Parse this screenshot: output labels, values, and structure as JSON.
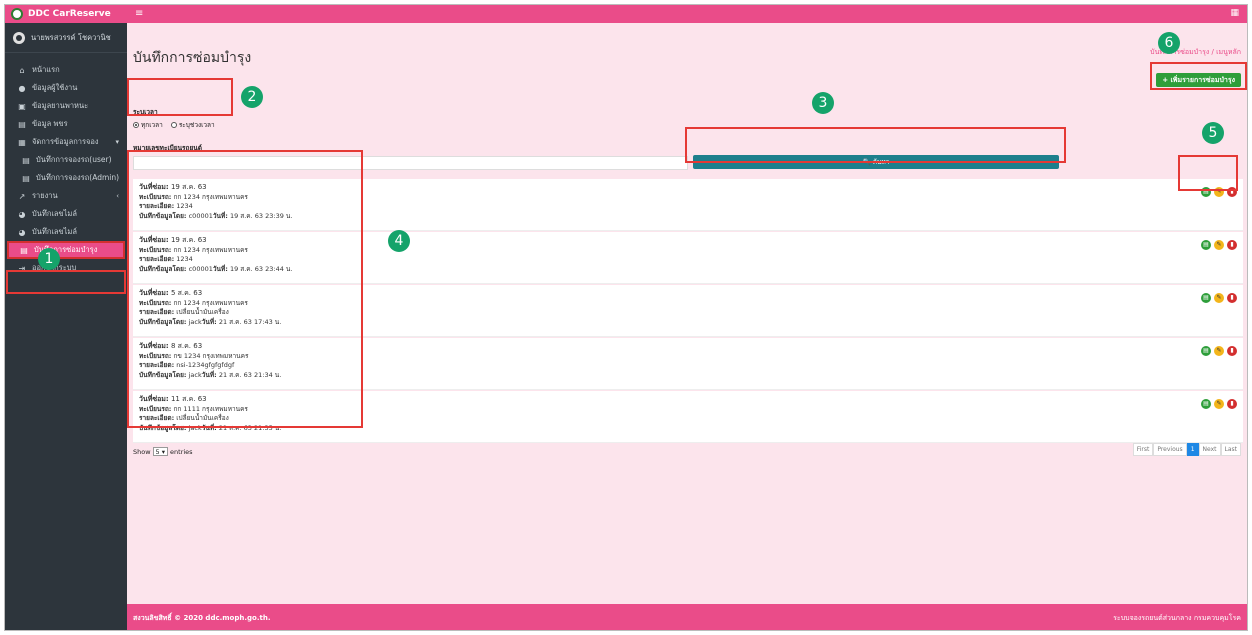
{
  "app": {
    "brand": "DDC CarReserve",
    "user_name": "นายพรสวรรค์ โชควานิช"
  },
  "sidebar": {
    "items": [
      {
        "icon": "home-icon",
        "label": "หน้าแรก"
      },
      {
        "icon": "user-icon",
        "label": "ข้อมูลผู้ใช้งาน"
      },
      {
        "icon": "car-icon",
        "label": "ข้อมูลยานพาหนะ"
      },
      {
        "icon": "card-icon",
        "label": "ข้อมูล พขร"
      },
      {
        "icon": "calendar-icon",
        "label": "จัดการข้อมูลการจอง"
      },
      {
        "icon": "list-icon",
        "label": "บันทึกการจองรถ(user)"
      },
      {
        "icon": "list-icon",
        "label": "บันทึกการจองรถ(Admin)"
      },
      {
        "icon": "chart-icon",
        "label": "รายงาน"
      },
      {
        "icon": "mileage-icon",
        "label": "บันทึกเลขไมล์"
      },
      {
        "icon": "mileage-icon",
        "label": "บันทึกเลขไมล์"
      },
      {
        "icon": "wrench-icon",
        "label": "บันทึกการซ่อมบำรุง"
      },
      {
        "icon": "logout-icon",
        "label": "ออกจากระบบ"
      }
    ]
  },
  "page": {
    "title": "บันทึกการซ่อมบำรุง",
    "breadcrumb": "บันทึกการซ่อมบำรุง / เมนูหลัก",
    "add_button": "+ เพิ่มรายการซ่อมบำรุง"
  },
  "filter": {
    "range_label": "ระบุเวลา",
    "opt_all": "ทุกเวลา",
    "opt_range": "ระบุช่วงเวลา",
    "plate_label": "หมายเลขทะเบียนรถยนต์",
    "search_button": "🔍 ค้นหา"
  },
  "labels": {
    "date": "วันที่ซ่อม:",
    "plate": "ทะเบียนรถ:",
    "detail": "รายละเอียด:",
    "recorder": "บันทึกข้อมูลโดย:",
    "recorded_at": "วันที่:"
  },
  "records": [
    {
      "date": "19 ส.ค. 63",
      "plate": "กก 1234 กรุงเทพมหานคร",
      "detail": "1234",
      "by": "c00001",
      "at": "19 ส.ค. 63 23:39 น."
    },
    {
      "date": "19 ส.ค. 63",
      "plate": "กก 1234 กรุงเทพมหานคร",
      "detail": "1234",
      "by": "c00001",
      "at": "19 ส.ค. 63 23:44 น."
    },
    {
      "date": "5 ส.ค. 63",
      "plate": "กก 1234 กรุงเทพมหานคร",
      "detail": "เปลี่ยนน้ำมันเครื่อง",
      "by": "jack",
      "at": "21 ส.ค. 63 17:43 น."
    },
    {
      "date": "8 ส.ค. 63",
      "plate": "กข 1234 กรุงเทพมหานคร",
      "detail": "nsi-1234gfgfgfdgf",
      "by": "jack",
      "at": "21 ส.ค. 63 21:34 น."
    },
    {
      "date": "11 ส.ค. 63",
      "plate": "กก 1111 กรุงเทพมหานคร",
      "detail": "เปลี่ยนน้ำมันเครื่อง",
      "by": "jack",
      "at": "21 ส.ค. 63 21:35 น."
    }
  ],
  "table_footer": {
    "show": "Show",
    "entries_value": "5",
    "entries": "entries",
    "pager": [
      "First",
      "Previous",
      "1",
      "Next",
      "Last"
    ]
  },
  "footer": {
    "left": "สงวนลิขสิทธิ์ © 2020 ddc.moph.go.th.",
    "right": "ระบบจองรถยนต์ส่วนกลาง กรมควบคุมโรค"
  },
  "annotations": [
    "1",
    "2",
    "3",
    "4",
    "5",
    "6"
  ],
  "colors": {
    "primary": "#ea4c89",
    "sidebar": "#2d353c",
    "search": "#1e7f8c",
    "add": "#2e9e3a",
    "highlight": "#e53935",
    "badge": "#15a36a"
  }
}
